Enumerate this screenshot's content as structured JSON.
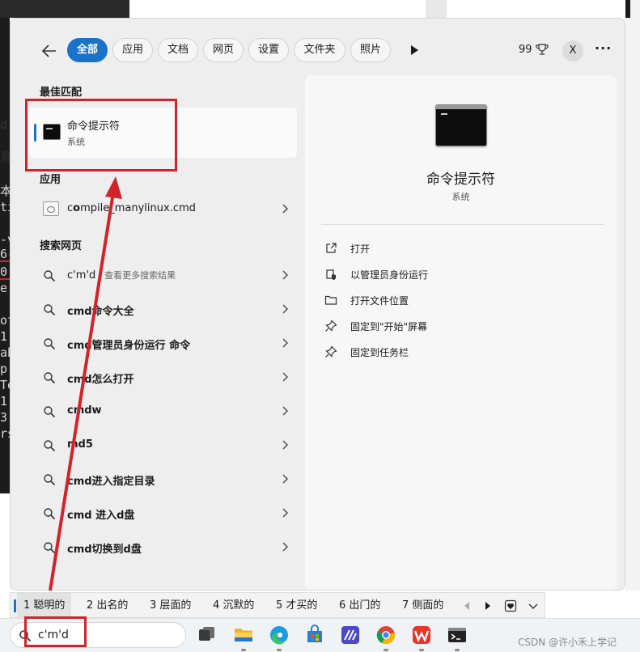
{
  "background": {
    "fragments": [
      "d",
      "意",
      "本",
      "ti",
      "-v",
      "6-",
      "0",
      "e",
      "of",
      "1",
      "ab",
      "p",
      "Te",
      "1.",
      "3.",
      "rs"
    ]
  },
  "filters": {
    "chips": [
      {
        "label": "全部",
        "active": true
      },
      {
        "label": "应用",
        "active": false
      },
      {
        "label": "文档",
        "active": false
      },
      {
        "label": "网页",
        "active": false
      },
      {
        "label": "设置",
        "active": false
      },
      {
        "label": "文件夹",
        "active": false
      },
      {
        "label": "照片",
        "active": false
      }
    ],
    "points": "99",
    "avatar": "X",
    "more": "···"
  },
  "best_match": {
    "heading": "最佳匹配",
    "title": "命令提示符",
    "subtitle": "系统"
  },
  "apps": {
    "heading": "应用",
    "items": [
      {
        "pre": "c",
        "bold": "o",
        "rest": "mpile_manylinux.cmd"
      }
    ]
  },
  "web": {
    "heading": "搜索网页",
    "items": [
      {
        "bold": "",
        "rest": "c'm'd",
        "hint": " - 查看更多搜索结果"
      },
      {
        "bold": "cmd命令大全",
        "rest": "",
        "hint": ""
      },
      {
        "bold": "cmd管理员身份运行 命令",
        "rest": "",
        "hint": ""
      },
      {
        "bold": "cmd怎么打开",
        "rest": "",
        "hint": ""
      },
      {
        "bold": "cmdw",
        "rest": "",
        "hint": ""
      },
      {
        "bold": "md5",
        "rest": "",
        "hint": ""
      },
      {
        "bold": "cmd进入指定目录",
        "rest": "",
        "hint": ""
      },
      {
        "bold": "cmd 进入d盘",
        "rest": "",
        "hint": ""
      },
      {
        "bold": "cmd切换到d盘",
        "rest": "",
        "hint": ""
      }
    ]
  },
  "detail": {
    "title": "命令提示符",
    "subtitle": "系统",
    "actions": [
      {
        "label": "打开",
        "icon": "open-external-icon"
      },
      {
        "label": "以管理员身份运行",
        "icon": "shield-icon"
      },
      {
        "label": "打开文件位置",
        "icon": "folder-icon"
      },
      {
        "label": "固定到\"开始\"屏幕",
        "icon": "pin-icon"
      },
      {
        "label": "固定到任务栏",
        "icon": "pin-icon"
      }
    ]
  },
  "ime": {
    "candidates": [
      "1 聪明的",
      "2 出名的",
      "3 层面的",
      "4 沉默的",
      "5 才买的",
      "6 出门的",
      "7 侧面的"
    ]
  },
  "taskbar": {
    "search_value": "c'm'd",
    "watermark": "CSDN @许小禾上学记",
    "icons": [
      "task-view-icon",
      "file-explorer-icon",
      "edge-icon",
      "store-icon",
      "editor-icon",
      "chrome-icon",
      "wps-icon",
      "terminal-icon"
    ]
  },
  "colors": {
    "accent": "#1a73c8",
    "annotation": "#d2232a"
  }
}
